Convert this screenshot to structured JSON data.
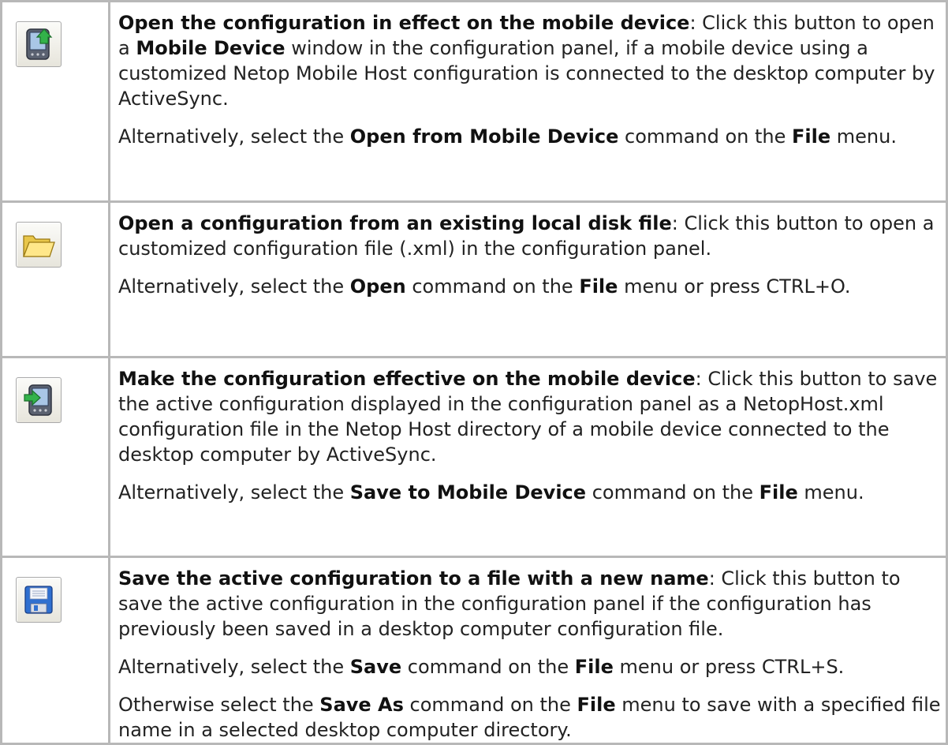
{
  "rows": [
    {
      "icon": "mobile-device-open-icon",
      "p1": {
        "bold": "Open the configuration in effect on the mobile device",
        "t1": ": Click this button to open a ",
        "b2": "Mobile Device",
        "t2": " window in the configuration panel, if a mobile device using a customized Netop Mobile Host configuration is connected to the desktop computer by ActiveSync."
      },
      "p2": {
        "t1": "Alternatively, select the ",
        "b1": "Open from Mobile Device",
        "t2": " command on the ",
        "b2": "File",
        "t3": " menu."
      }
    },
    {
      "icon": "folder-open-icon",
      "p1": {
        "bold": "Open a configuration from an existing local disk file",
        "t1": ": Click this button to open a customized configuration file (.xml) in the configuration panel."
      },
      "p2": {
        "t1": "Alternatively, select the ",
        "b1": "Open",
        "t2": " command on the ",
        "b2": "File",
        "t3": " menu or press CTRL+O."
      }
    },
    {
      "icon": "mobile-device-save-icon",
      "p1": {
        "bold": "Make the configuration effective on the mobile device",
        "t1": ": Click this button to save the active configuration displayed in the configuration panel as a NetopHost.xml configuration file in the Netop Host directory of a mobile device connected to the desktop computer by ActiveSync."
      },
      "p2": {
        "t1": "Alternatively, select the ",
        "b1": "Save to Mobile Device",
        "t2": " command on the ",
        "b2": "File",
        "t3": " menu."
      }
    },
    {
      "icon": "floppy-disk-save-icon",
      "p1": {
        "bold": "Save the active configuration to a file with a new name",
        "t1": ": Click this button to save the active configuration in the configuration panel if the configuration has previously been saved in a desktop computer configuration file."
      },
      "p2": {
        "t1": "Alternatively, select the ",
        "b1": "Save",
        "t2": " command on the ",
        "b2": "File",
        "t3": " menu or press CTRL+S."
      },
      "p3": {
        "t1": "Otherwise select the ",
        "b1": "Save As",
        "t2": " command on the ",
        "b2": "File",
        "t3": " menu to save with a specified file name in a selected desktop computer directory."
      }
    }
  ],
  "colors": {
    "grid": "#b8b8b8",
    "text": "#222222"
  }
}
